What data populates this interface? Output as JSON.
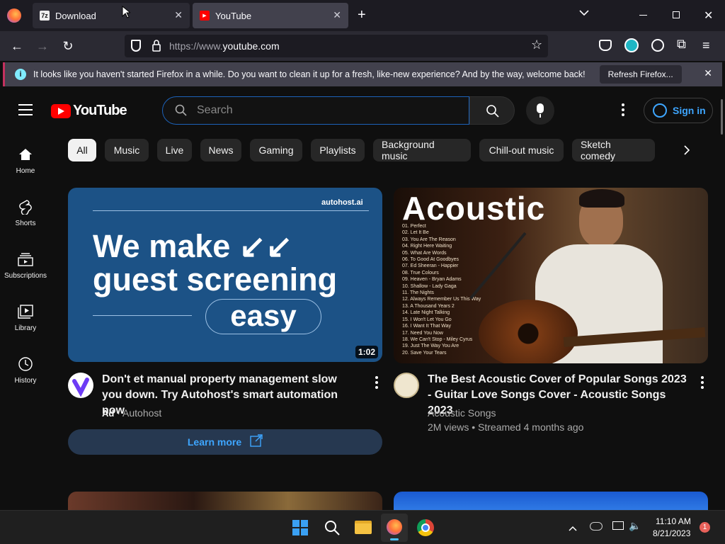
{
  "browser": {
    "tabs": [
      {
        "label": "Download",
        "favicon": "7z-icon"
      },
      {
        "label": "YouTube",
        "favicon": "youtube-icon"
      }
    ],
    "url_scheme": "https://www.",
    "url_host": "youtube.com",
    "infobar": {
      "message": "It looks like you haven't started Firefox in a while. Do you want to clean it up for a fresh, like-new experience? And by the way, welcome back!",
      "button": "Refresh Firefox..."
    },
    "colors": {
      "accent": "#c4305e",
      "chrome": "#2b2a33"
    }
  },
  "youtube": {
    "logo_text": "YouTube",
    "search_placeholder": "Search",
    "sign_in": "Sign in",
    "chips": [
      "All",
      "Music",
      "Live",
      "News",
      "Gaming",
      "Playlists",
      "Background music",
      "Chill-out music",
      "Sketch comedy"
    ],
    "sidebar": [
      "Home",
      "Shorts",
      "Subscriptions",
      "Library",
      "History"
    ],
    "videos": [
      {
        "thumb_brand": "autohost.ai",
        "thumb_line1": "We make",
        "thumb_line2": "guest screening",
        "thumb_line3": "easy",
        "duration": "1:02",
        "title": "Don't et manual property management slow you down. Try Autohost's smart automation now",
        "ad_label": "Ad",
        "channel": "Autohost",
        "cta": "Learn more"
      },
      {
        "thumb_title": "Acoustic",
        "tracklist": [
          "01. Perfect",
          "02. Let It Be",
          "03. You Are The Reason",
          "04. Right Here Waiting",
          "05. What Are Words",
          "06. To Good At Goodbyes",
          "07. Ed Sheeran - Happier",
          "08. True Colours",
          "09. Heaven - Bryan Adams",
          "10. Shallow - Lady Gaga",
          "11. The Nights",
          "12. Always Remember Us This Way",
          "13. A Thousand Years 2",
          "14. Late Night Talking",
          "15. I Won't Let You Go",
          "16. I Want It That Way",
          "17. Need You Now",
          "18. We Can't Stop - Miley Cyrus",
          "19. Just The Way You Are",
          "20. Save Your Tears"
        ],
        "title": "The Best Acoustic Cover of Popular Songs 2023 - Guitar Love Songs Cover - Acoustic Songs 2023",
        "channel": "Acoustic Songs",
        "stats": "2M views • Streamed 4 months ago"
      }
    ]
  },
  "taskbar": {
    "time": "11:10 AM",
    "date": "8/21/2023",
    "notifications": "1"
  }
}
